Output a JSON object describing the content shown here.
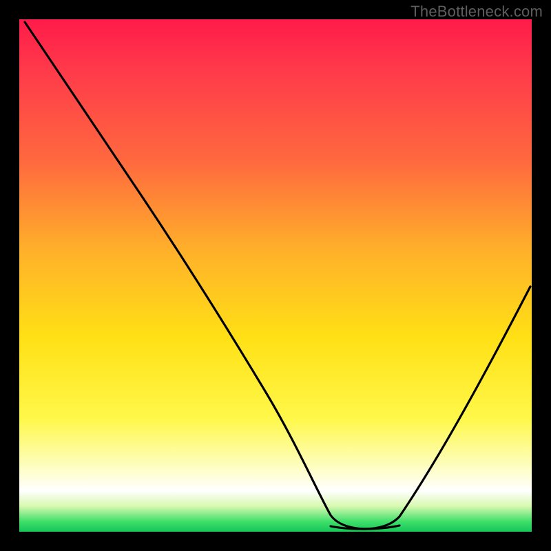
{
  "watermark": "TheBottleneck.com",
  "colors": {
    "gradient_top": "#ff1b4a",
    "gradient_mid1": "#ff6a3e",
    "gradient_mid2": "#ffe015",
    "gradient_bottom": "#14c758",
    "curve": "#000000",
    "trough": "#d96a5a",
    "frame": "#000000",
    "watermark": "#5e5e5e"
  },
  "chart_data": {
    "type": "line",
    "title": "",
    "xlabel": "",
    "ylabel": "",
    "x": [
      0,
      5,
      10,
      15,
      20,
      25,
      30,
      35,
      40,
      45,
      50,
      55,
      60,
      63,
      67,
      70,
      73,
      76,
      80,
      85,
      90,
      95,
      100
    ],
    "values": [
      100,
      92,
      84,
      76,
      68,
      60,
      52,
      44,
      36,
      28,
      20,
      12,
      5,
      1,
      0,
      0,
      0,
      1,
      5,
      13,
      24,
      37,
      52
    ],
    "xlim": [
      0,
      100
    ],
    "ylim": [
      0,
      100
    ],
    "trough_range_x": [
      60,
      76
    ],
    "notes": "V-shaped bottleneck curve over a red-to-green vertical gradient; minimum (optimal match) sits around x≈63–73 at y≈0. Left branch descends from (0,100); right branch rises to roughly (100,52). A short salmon bar highlights the flat trough."
  }
}
